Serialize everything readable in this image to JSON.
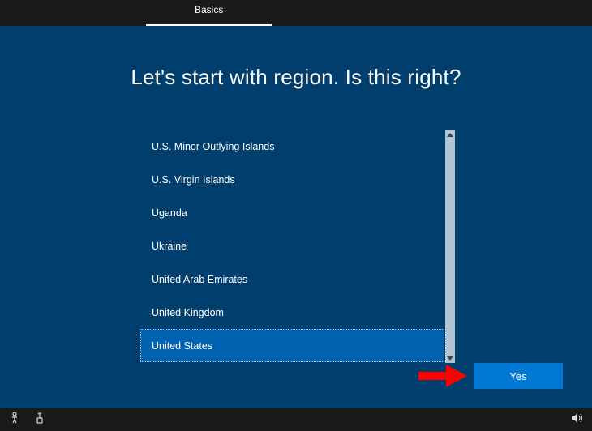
{
  "header": {
    "tab_label": "Basics"
  },
  "main": {
    "title": "Let's start with region. Is this right?",
    "regions": [
      "U.S. Minor Outlying Islands",
      "U.S. Virgin Islands",
      "Uganda",
      "Ukraine",
      "United Arab Emirates",
      "United Kingdom",
      "United States"
    ],
    "selected_region": "United States",
    "confirm_button": "Yes"
  }
}
